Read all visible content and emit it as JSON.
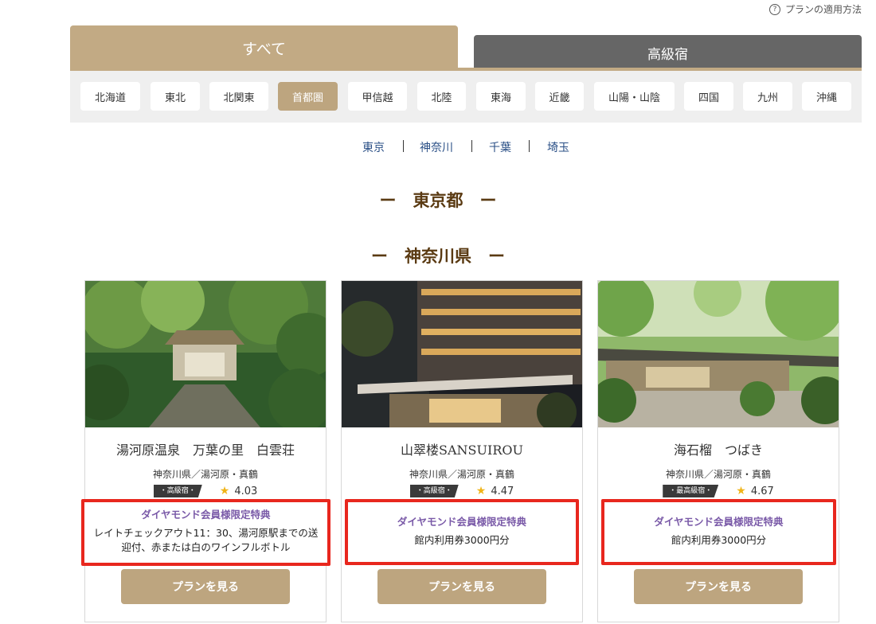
{
  "help": {
    "icon": "question-circle-icon",
    "label": "プランの適用方法"
  },
  "tabs": {
    "all": "すべて",
    "luxury": "高級宿"
  },
  "regions": [
    {
      "label": "北海道"
    },
    {
      "label": "東北"
    },
    {
      "label": "北関東"
    },
    {
      "label": "首都圏",
      "active": true
    },
    {
      "label": "甲信越"
    },
    {
      "label": "北陸"
    },
    {
      "label": "東海"
    },
    {
      "label": "近畿"
    },
    {
      "label": "山陽・山陰"
    },
    {
      "label": "四国"
    },
    {
      "label": "九州"
    },
    {
      "label": "沖縄"
    }
  ],
  "prefectures": [
    "東京",
    "神奈川",
    "千葉",
    "埼玉"
  ],
  "sections": {
    "tokyo": "ー　東京都　ー",
    "kanagawa": "ー　神奈川県　ー"
  },
  "cards": [
    {
      "name": "湯河原温泉　万葉の里　白雲荘",
      "location": "神奈川県／湯河原・真鶴",
      "grade": "・高級宿・",
      "rating": "4.03",
      "benefit_title": "ダイヤモンド会員様限定特典",
      "benefit_text": "レイトチェックアウト11：30、湯河原駅までの送迎付、赤または白のワインフルボトル",
      "button": "プランを見る"
    },
    {
      "name": "山翠楼SANSUIROU",
      "location": "神奈川県／湯河原・真鶴",
      "grade": "・高級宿・",
      "rating": "4.47",
      "benefit_title": "ダイヤモンド会員様限定特典",
      "benefit_text": "館内利用券3000円分",
      "button": "プランを見る"
    },
    {
      "name": "海石榴　つばき",
      "location": "神奈川県／湯河原・真鶴",
      "grade": "・最高級宿・",
      "rating": "4.67",
      "benefit_title": "ダイヤモンド会員様限定特典",
      "benefit_text": "館内利用券3000円分",
      "button": "プランを見る"
    }
  ],
  "colors": {
    "tab_active": "#c2aa84",
    "tab_inactive": "#666666",
    "region_active": "#bda57f",
    "link": "#2a4f86",
    "heading": "#5a3a12",
    "highlight_border": "#e8271e",
    "benefit_title": "#7a5aa8",
    "star": "#f0b418"
  }
}
